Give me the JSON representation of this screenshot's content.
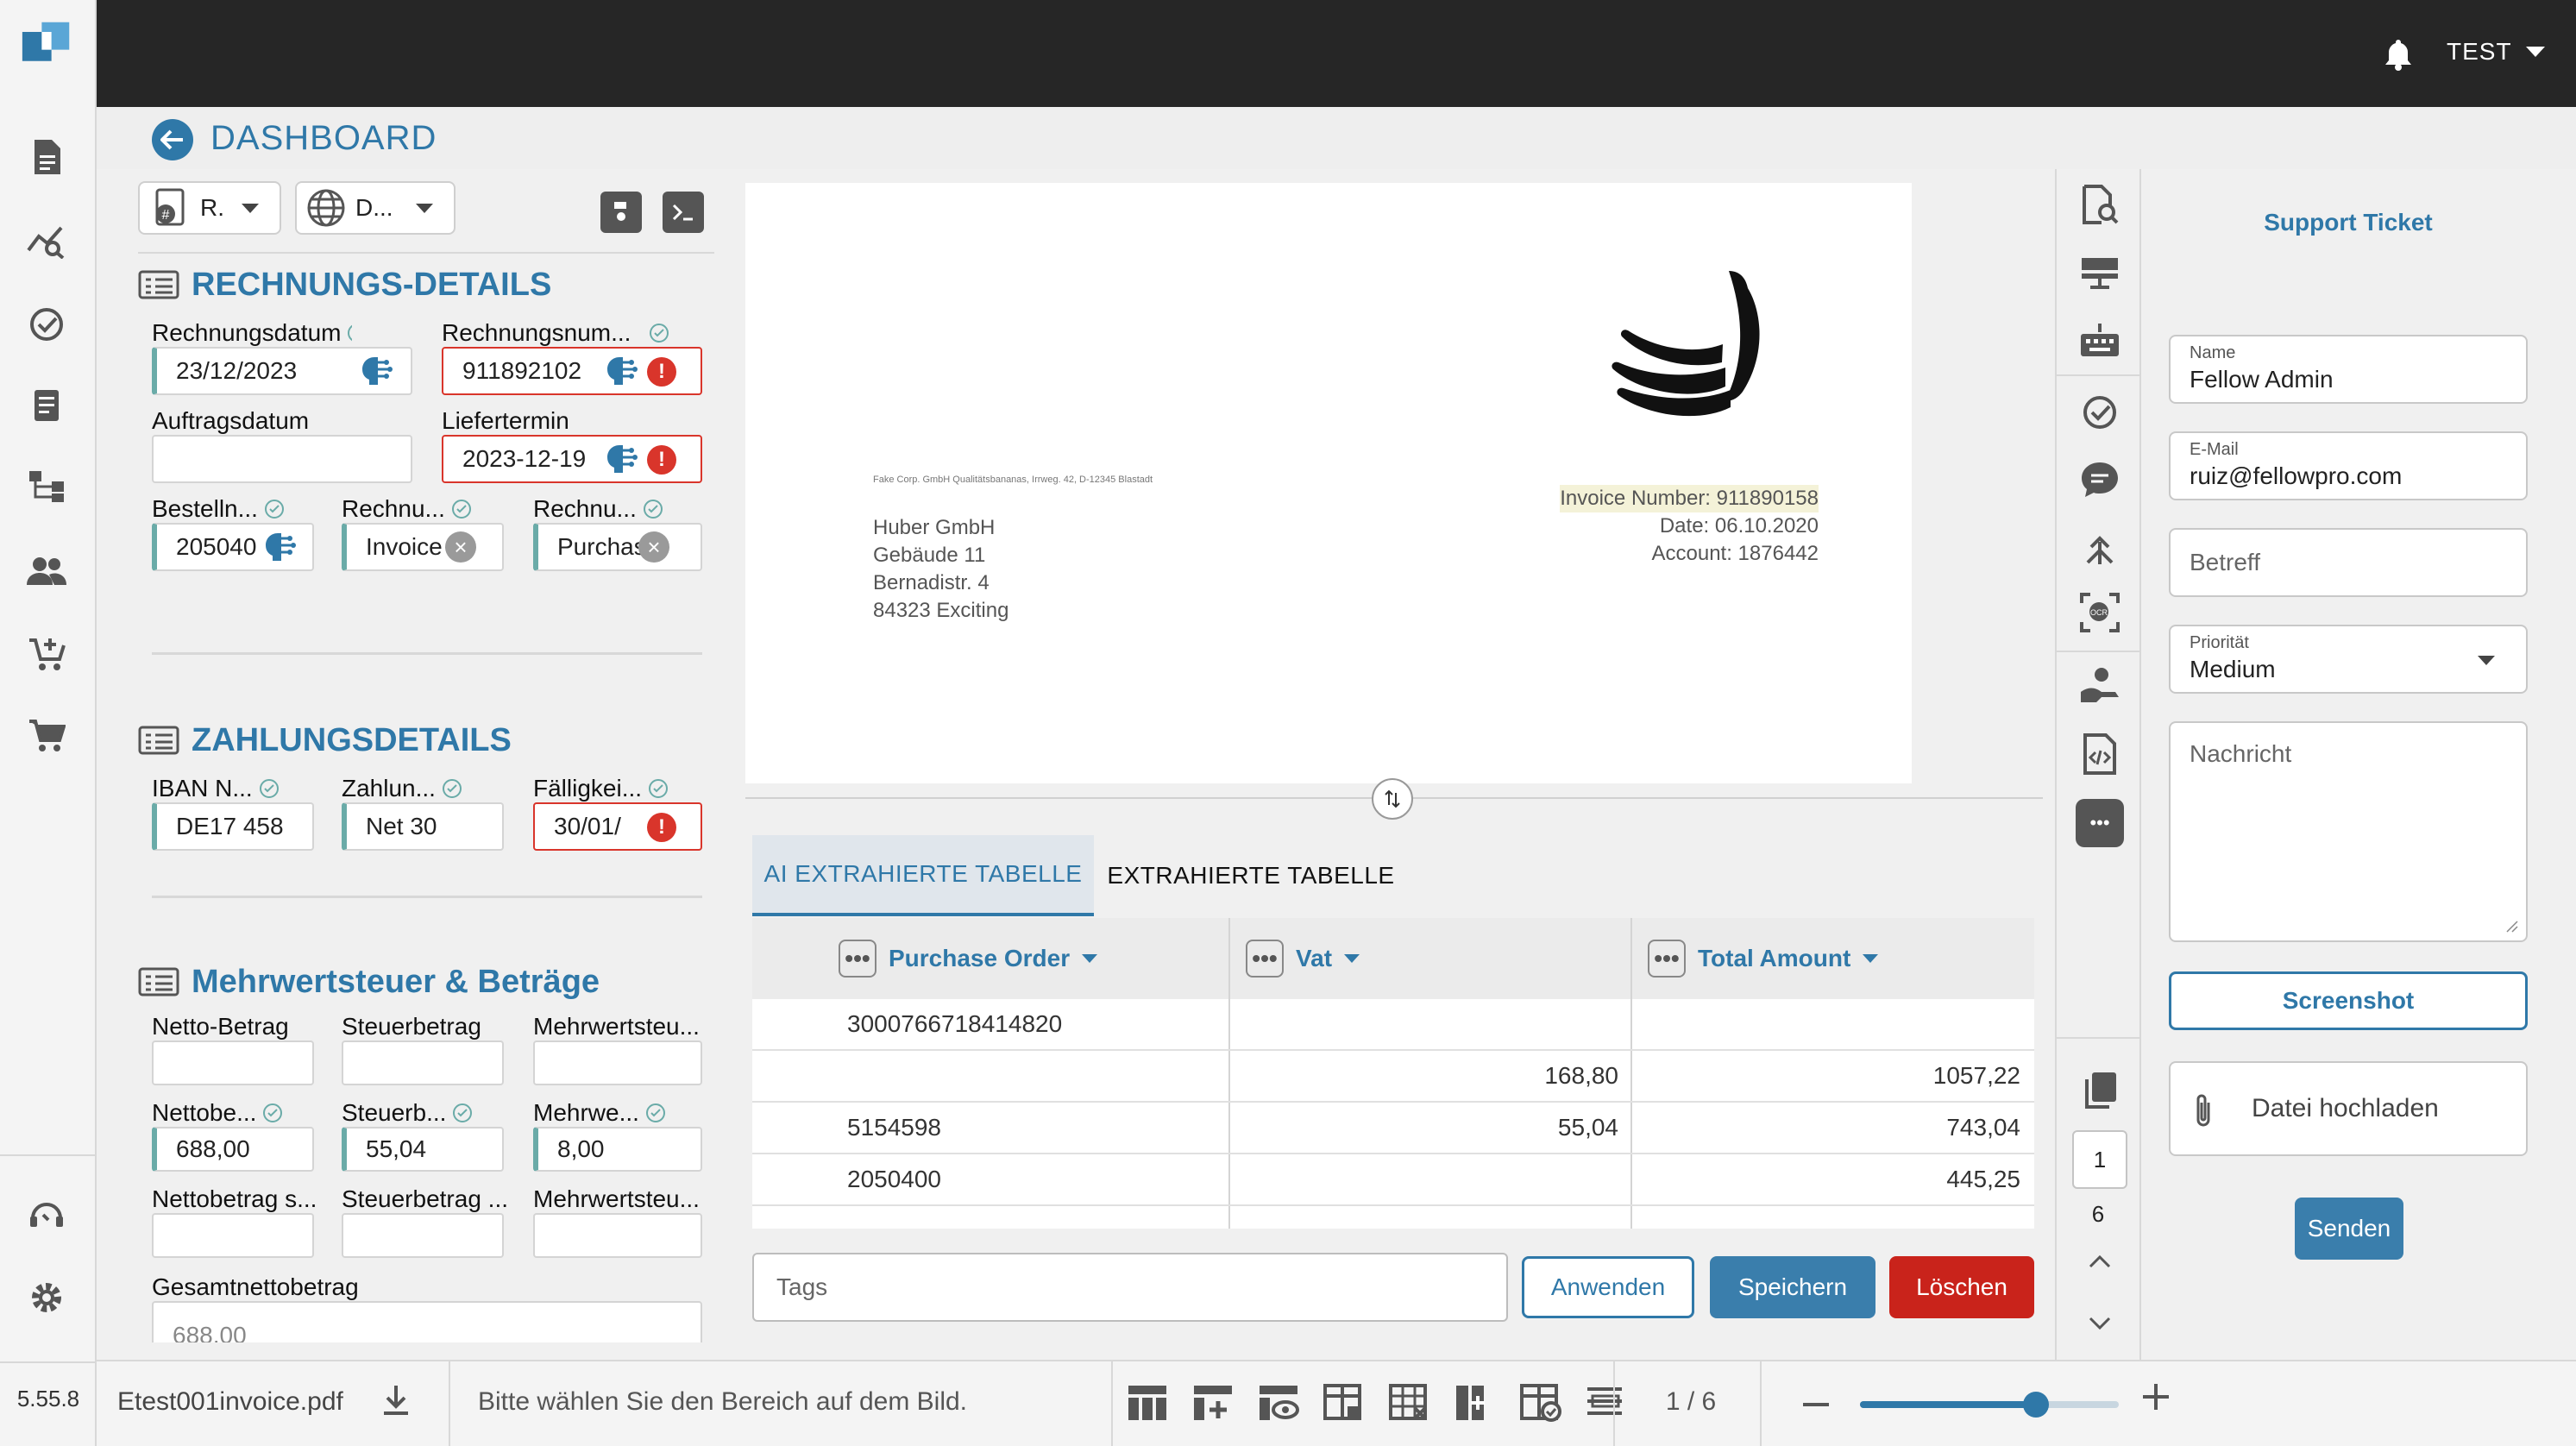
{
  "app": {
    "version": "5.55.8"
  },
  "topbar": {
    "user": "TEST"
  },
  "header": {
    "title": "DASHBOARD"
  },
  "toolbar": {
    "template_select": "R.",
    "language_select": "D..."
  },
  "sections": {
    "invoice": {
      "title": "RECHNUNGS-DETAILS",
      "fields": {
        "rechnungsdatum": {
          "label": "Rechnungsdatum",
          "value": "23/12/2023"
        },
        "rechnungsnummer": {
          "label": "Rechnungsnum...",
          "value": "911892102"
        },
        "auftragsdatum": {
          "label": "Auftragsdatum",
          "value": ""
        },
        "liefertermin": {
          "label": "Liefertermin",
          "value": "2023-12-19"
        },
        "bestellnummer": {
          "label": "Bestelln...",
          "value": "205040"
        },
        "rechnungstyp": {
          "label": "Rechnu...",
          "value": "Invoice"
        },
        "rechnungsart": {
          "label": "Rechnu...",
          "value": "Purchase"
        }
      }
    },
    "payment": {
      "title": "ZAHLUNGSDETAILS",
      "fields": {
        "iban": {
          "label": "IBAN N...",
          "value": "DE17 458"
        },
        "zahlungsbedingung": {
          "label": "Zahlun...",
          "value": "Net 30"
        },
        "faelligkeit": {
          "label": "Fälligkei...",
          "value": "30/01/"
        }
      }
    },
    "tax": {
      "title": "Mehrwertsteuer & Beträge",
      "fields": {
        "netto_betrag": {
          "label": "Netto-Betrag",
          "value": ""
        },
        "steuerbetrag": {
          "label": "Steuerbetrag",
          "value": ""
        },
        "mehrwertsteuer": {
          "label": "Mehrwertsteu...",
          "value": ""
        },
        "nettobetrag2": {
          "label": "Nettobe...",
          "value": "688,00"
        },
        "steuerbetrag2": {
          "label": "Steuerb...",
          "value": "55,04"
        },
        "mehrwertsteuer2": {
          "label": "Mehrwe...",
          "value": "8,00"
        },
        "nettobetrag_s": {
          "label": "Nettobetrag s...",
          "value": ""
        },
        "steuerbetrag3": {
          "label": "Steuerbetrag ...",
          "value": ""
        },
        "mehrwertsteuer3": {
          "label": "Mehrwertsteu...",
          "value": ""
        },
        "gesamtnettobetrag": {
          "label": "Gesamtnettobetrag",
          "value": "688,00"
        }
      }
    }
  },
  "document": {
    "sender_line": "Fake Corp. GmbH Qualitätsbananas, Irrweg. 42, D-12345 Blastadt",
    "recipient": [
      "Huber GmbH",
      "Gebäude 11",
      "Bernadistr. 4",
      "84323 Exciting"
    ],
    "meta": [
      "Invoice Number: 911890158",
      "Date: 06.10.2020",
      "Account: 1876442"
    ]
  },
  "tabs": [
    {
      "label": "AI EXTRAHIERTE TABELLE",
      "active": true
    },
    {
      "label": "EXTRAHIERTE TABELLE",
      "active": false
    }
  ],
  "table": {
    "columns": [
      "Purchase Order",
      "Vat",
      "Total Amount"
    ],
    "rows": [
      [
        "3000766718414820",
        "",
        ""
      ],
      [
        "",
        "168,80",
        "1057,22"
      ],
      [
        "5154598",
        "55,04",
        "743,04"
      ],
      [
        "2050400",
        "",
        "445,25"
      ]
    ]
  },
  "actions": {
    "tags_placeholder": "Tags",
    "apply": "Anwenden",
    "save": "Speichern",
    "delete": "Löschen"
  },
  "pager": {
    "current": "1",
    "total": "6"
  },
  "support": {
    "title": "Support Ticket",
    "name_label": "Name",
    "name_value": "Fellow Admin",
    "email_label": "E-Mail",
    "email_value": "ruiz@fellowpro.com",
    "subject_placeholder": "Betreff",
    "priority_label": "Priorität",
    "priority_value": "Medium",
    "message_placeholder": "Nachricht",
    "screenshot": "Screenshot",
    "upload": "Datei hochladen",
    "send": "Senden"
  },
  "bottom": {
    "filename": "Etest001invoice.pdf",
    "hint": "Bitte wählen Sie den Bereich auf dem Bild.",
    "page_indicator": "1 / 6",
    "zoom": 0.68
  },
  "colors": {
    "accent": "#2f78a8",
    "error": "#d9352b",
    "valid": "#6aaba8",
    "topbar": "#262626"
  }
}
